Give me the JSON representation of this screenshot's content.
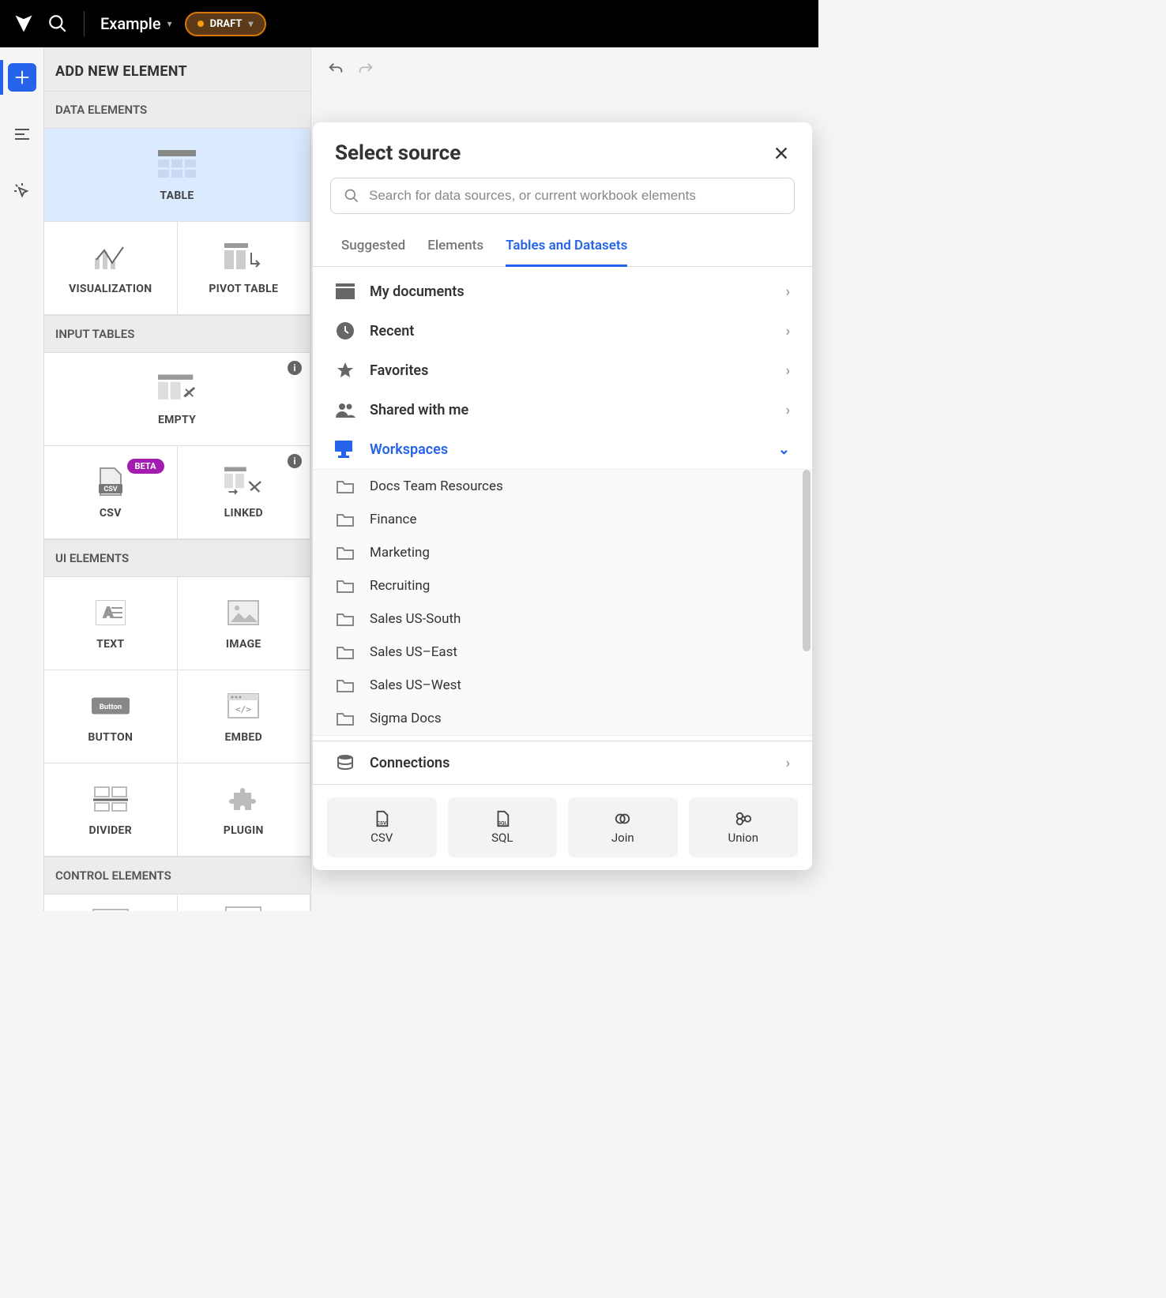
{
  "topbar": {
    "title": "Example",
    "draft_label": "DRAFT"
  },
  "panel": {
    "header": "ADD NEW ELEMENT",
    "sections": {
      "data": "DATA ELEMENTS",
      "input": "INPUT TABLES",
      "ui": "UI ELEMENTS",
      "control": "CONTROL ELEMENTS"
    },
    "tiles": {
      "table": "TABLE",
      "visualization": "VISUALIZATION",
      "pivot": "PIVOT TABLE",
      "empty": "EMPTY",
      "csv": "CSV",
      "linked": "LINKED",
      "text": "TEXT",
      "image": "IMAGE",
      "button": "BUTTON",
      "embed": "EMBED",
      "divider": "DIVIDER",
      "plugin": "PLUGIN"
    },
    "badges": {
      "beta": "BETA"
    }
  },
  "modal": {
    "title": "Select source",
    "search_placeholder": "Search for data sources, or current workbook elements",
    "tabs": {
      "suggested": "Suggested",
      "elements": "Elements",
      "tables": "Tables and Datasets"
    },
    "sources": {
      "my_documents": "My documents",
      "recent": "Recent",
      "favorites": "Favorites",
      "shared": "Shared with me",
      "workspaces": "Workspaces",
      "connections": "Connections"
    },
    "workspace_folders": [
      "Docs Team Resources",
      "Finance",
      "Marketing",
      "Recruiting",
      "Sales US-South",
      "Sales US–East",
      "Sales US–West",
      "Sigma Docs"
    ],
    "footer_buttons": {
      "csv": "CSV",
      "sql": "SQL",
      "join": "Join",
      "union": "Union"
    }
  }
}
